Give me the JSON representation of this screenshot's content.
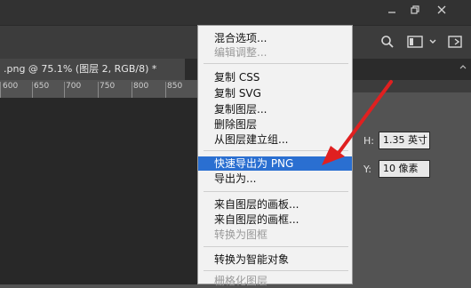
{
  "window": {
    "minimize_icon": "minimize-icon",
    "restore_icon": "restore-icon",
    "close_icon": "close-icon"
  },
  "toolbar": {
    "search_icon": "search-icon",
    "workspace_icon": "workspace-icon",
    "chevron_icon": "chevron-down-icon"
  },
  "document_tab": {
    "title": ".png @ 75.1% (图层 2, RGB/8) *"
  },
  "ruler": {
    "labels": [
      "600",
      "650",
      "700",
      "750",
      "800",
      "850"
    ]
  },
  "properties": {
    "h_label": "H:",
    "h_value": "1.35 英寸",
    "y_label": "Y:",
    "y_value": "10 像素"
  },
  "context_menu": {
    "items": [
      {
        "label": "混合选项...",
        "disabled": false
      },
      {
        "label": "编辑调整...",
        "disabled": true
      },
      {
        "label": "复制 CSS",
        "disabled": false
      },
      {
        "label": "复制 SVG",
        "disabled": false
      },
      {
        "label": "复制图层...",
        "disabled": false
      },
      {
        "label": "删除图层",
        "disabled": false
      },
      {
        "label": "从图层建立组...",
        "disabled": false
      },
      {
        "label": "快速导出为 PNG",
        "disabled": false,
        "highlighted": true
      },
      {
        "label": "导出为...",
        "disabled": false
      },
      {
        "label": "来自图层的画板...",
        "disabled": false
      },
      {
        "label": "来自图层的画框...",
        "disabled": false
      },
      {
        "label": "转换为图框",
        "disabled": true
      },
      {
        "label": "转换为智能对象",
        "disabled": false
      },
      {
        "label": "栅格化图层",
        "disabled": true
      }
    ]
  },
  "colors": {
    "highlight": "#2a6fd1",
    "arrow": "#e02020"
  }
}
